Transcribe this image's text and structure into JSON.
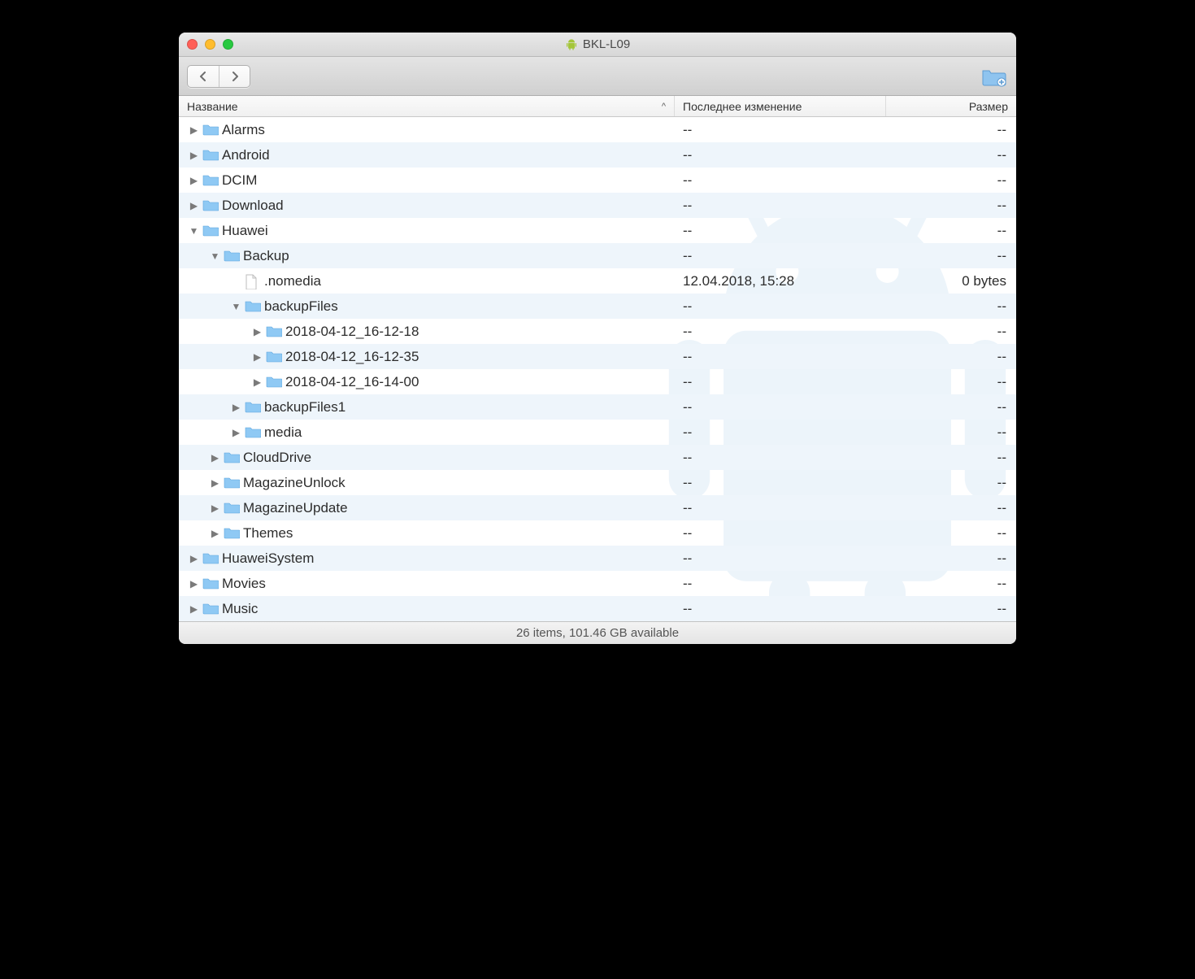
{
  "window": {
    "title": "BKL-L09",
    "icon": "android-icon"
  },
  "columns": {
    "name": "Название",
    "modified": "Последнее изменение",
    "size": "Размер",
    "sort_indicator": "^"
  },
  "placeholders": {
    "dashdash": "--"
  },
  "rows": [
    {
      "depth": 0,
      "type": "folder",
      "expanded": false,
      "name": "Alarms",
      "modified": "--",
      "size": "--"
    },
    {
      "depth": 0,
      "type": "folder",
      "expanded": false,
      "name": "Android",
      "modified": "--",
      "size": "--"
    },
    {
      "depth": 0,
      "type": "folder",
      "expanded": false,
      "name": "DCIM",
      "modified": "--",
      "size": "--"
    },
    {
      "depth": 0,
      "type": "folder",
      "expanded": false,
      "name": "Download",
      "modified": "--",
      "size": "--"
    },
    {
      "depth": 0,
      "type": "folder",
      "expanded": true,
      "name": "Huawei",
      "modified": "--",
      "size": "--"
    },
    {
      "depth": 1,
      "type": "folder",
      "expanded": true,
      "name": "Backup",
      "modified": "--",
      "size": "--"
    },
    {
      "depth": 2,
      "type": "file",
      "expanded": null,
      "name": ".nomedia",
      "modified": "12.04.2018, 15:28",
      "size": "0 bytes"
    },
    {
      "depth": 2,
      "type": "folder",
      "expanded": true,
      "name": "backupFiles",
      "modified": "--",
      "size": "--"
    },
    {
      "depth": 3,
      "type": "folder",
      "expanded": false,
      "name": "2018-04-12_16-12-18",
      "modified": "--",
      "size": "--"
    },
    {
      "depth": 3,
      "type": "folder",
      "expanded": false,
      "name": "2018-04-12_16-12-35",
      "modified": "--",
      "size": "--"
    },
    {
      "depth": 3,
      "type": "folder",
      "expanded": false,
      "name": "2018-04-12_16-14-00",
      "modified": "--",
      "size": "--"
    },
    {
      "depth": 2,
      "type": "folder",
      "expanded": false,
      "name": "backupFiles1",
      "modified": "--",
      "size": "--"
    },
    {
      "depth": 2,
      "type": "folder",
      "expanded": false,
      "name": "media",
      "modified": "--",
      "size": "--"
    },
    {
      "depth": 1,
      "type": "folder",
      "expanded": false,
      "name": "CloudDrive",
      "modified": "--",
      "size": "--"
    },
    {
      "depth": 1,
      "type": "folder",
      "expanded": false,
      "name": "MagazineUnlock",
      "modified": "--",
      "size": "--"
    },
    {
      "depth": 1,
      "type": "folder",
      "expanded": false,
      "name": "MagazineUpdate",
      "modified": "--",
      "size": "--"
    },
    {
      "depth": 1,
      "type": "folder",
      "expanded": false,
      "name": "Themes",
      "modified": "--",
      "size": "--"
    },
    {
      "depth": 0,
      "type": "folder",
      "expanded": false,
      "name": "HuaweiSystem",
      "modified": "--",
      "size": "--"
    },
    {
      "depth": 0,
      "type": "folder",
      "expanded": false,
      "name": "Movies",
      "modified": "--",
      "size": "--"
    },
    {
      "depth": 0,
      "type": "folder",
      "expanded": false,
      "name": "Music",
      "modified": "--",
      "size": "--"
    }
  ],
  "status": "26 items, 101.46 GB available"
}
